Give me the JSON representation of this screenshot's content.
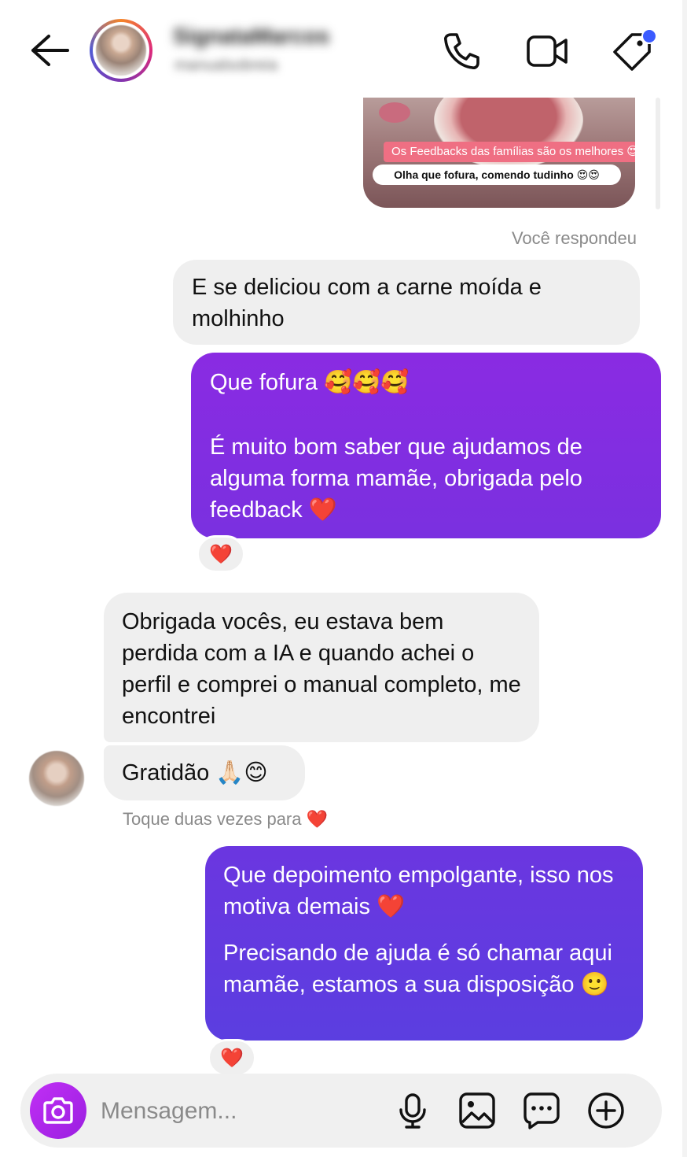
{
  "header": {
    "contact_name": "SignataMarcos",
    "contact_username": "manualsobreia"
  },
  "shared_media": {
    "tag": "Os Feedbacks das famílias são os melhores 😍",
    "caption": "Olha que fofura, comendo tudinho 😍😍"
  },
  "thread": {
    "you_replied": "Você respondeu",
    "replied_message": "E se deliciou com a carne moída e molhinho",
    "msg_out_1": {
      "line1": "Que fofura 🥰🥰🥰",
      "line2": "É muito bom saber que ajudamos de alguma forma mamãe, obrigada pelo feedback ❤️"
    },
    "reaction_1": "❤️",
    "msg_in_1": "Obrigada vocês, eu estava bem perdida com a IA e quando achei o perfil e comprei o manual completo, me encontrei",
    "msg_in_2": "Gratidão 🙏🏻😊",
    "double_tap_hint": "Toque duas vezes para ❤️",
    "msg_out_2": {
      "line1": "Que depoimento empolgante, isso nos motiva demais ❤️",
      "line2": "Precisando de ajuda é só chamar aqui mamãe, estamos a sua disposição 🙂"
    },
    "reaction_2": "❤️"
  },
  "composer": {
    "placeholder": "Mensagem..."
  },
  "colors": {
    "bubble_out_top": "#8a2be2",
    "bubble_out_bottom": "#5b3ee0",
    "bubble_in": "#efefef",
    "camera_button": "#a724e8",
    "notification_dot": "#3b5bff"
  },
  "icons": [
    "back-arrow-icon",
    "phone-icon",
    "video-camera-icon",
    "tag-icon",
    "camera-icon",
    "microphone-icon",
    "gallery-icon",
    "sticker-icon",
    "plus-icon"
  ]
}
